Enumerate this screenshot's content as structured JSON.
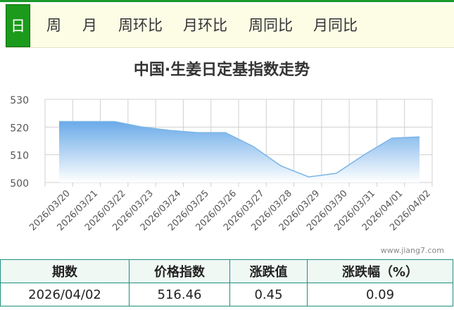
{
  "tabs": [
    {
      "label": "日",
      "active": true
    },
    {
      "label": "周",
      "active": false
    },
    {
      "label": "月",
      "active": false
    },
    {
      "label": "周环比",
      "active": false
    },
    {
      "label": "月环比",
      "active": false
    },
    {
      "label": "周同比",
      "active": false
    },
    {
      "label": "月同比",
      "active": false
    }
  ],
  "chart_data": {
    "type": "area",
    "title": "中国·生姜日定基指数走势",
    "categories": [
      "2026/03/20",
      "2026/03/21",
      "2026/03/22",
      "2026/03/23",
      "2026/03/24",
      "2026/03/25",
      "2026/03/26",
      "2026/03/27",
      "2026/03/28",
      "2026/03/29",
      "2026/03/30",
      "2026/03/31",
      "2026/04/01",
      "2026/04/02"
    ],
    "series": [
      {
        "values": [
          522.0,
          522.0,
          522.0,
          520.0,
          518.8,
          518.0,
          518.0,
          513.0,
          506.0,
          502.0,
          503.3,
          510.0,
          516.0,
          516.46
        ]
      }
    ],
    "ylim": [
      500,
      530
    ],
    "yticks": [
      500,
      510,
      520,
      530
    ],
    "grid": true,
    "colors": {
      "line": "#7bb5e6",
      "area_top": "#6aaae8",
      "area_bottom": "#ffffff",
      "grid": "#d0d0d0"
    },
    "watermark": "www.jiang7.com"
  },
  "table": {
    "headers": [
      "期数",
      "价格指数",
      "涨跌值",
      "涨跌幅（%）"
    ],
    "rows": [
      [
        "2026/04/02",
        "516.46",
        "0.45",
        "0.09"
      ]
    ]
  },
  "colors": {
    "accent": "#1b9a1b",
    "tabbar_bg": "#fdfde6",
    "table_border": "#1f8f7f",
    "header_bg": "#f0f8f4"
  }
}
